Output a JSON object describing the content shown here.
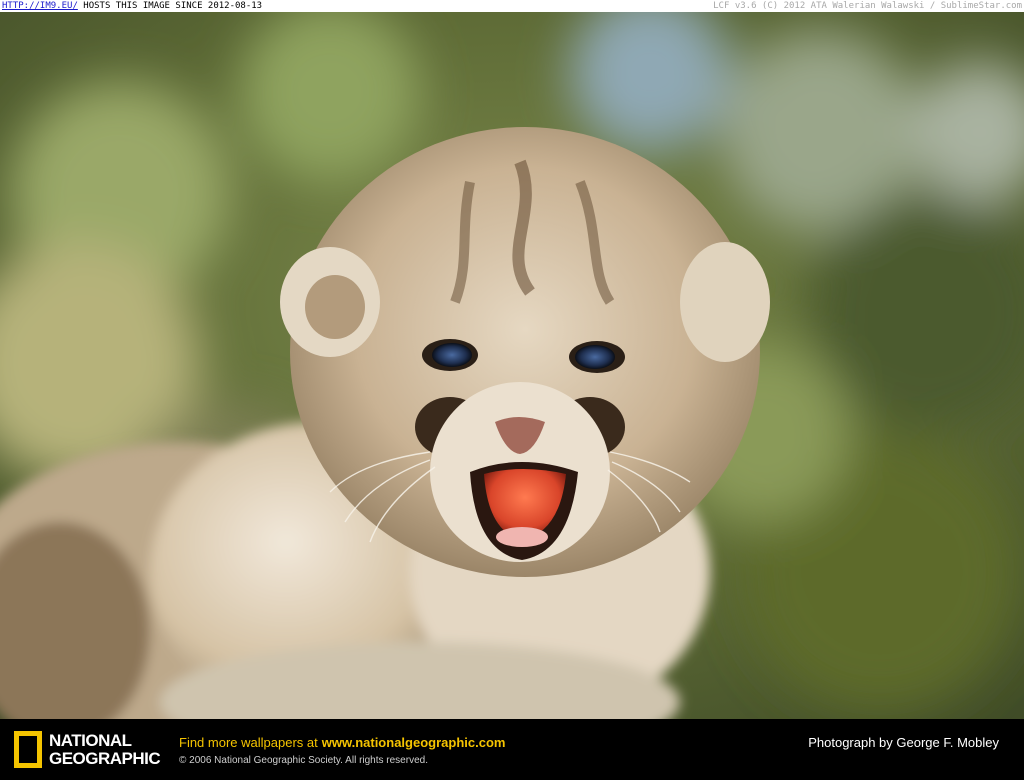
{
  "topbar": {
    "link_text": "HTTP://IM9.EU/",
    "host_text": "HOSTS THIS IMAGE SINCE 2012-08-13",
    "right_text": "LCF v3.6 (C) 2012 ATA Walerian Walawski / SublimeStar.com"
  },
  "photo": {
    "subject": "mountain lion cub, mouth open"
  },
  "footer": {
    "logo_line1": "NATIONAL",
    "logo_line2": "GEOGRAPHIC",
    "promo_text": "Find more wallpapers at",
    "promo_site": "www.nationalgeographic.com",
    "copyright": "© 2006 National Geographic Society. All rights reserved.",
    "credit": "Photograph by George F. Mobley"
  },
  "colors": {
    "brand_yellow": "#f5c400",
    "footer_bg": "#000000"
  }
}
